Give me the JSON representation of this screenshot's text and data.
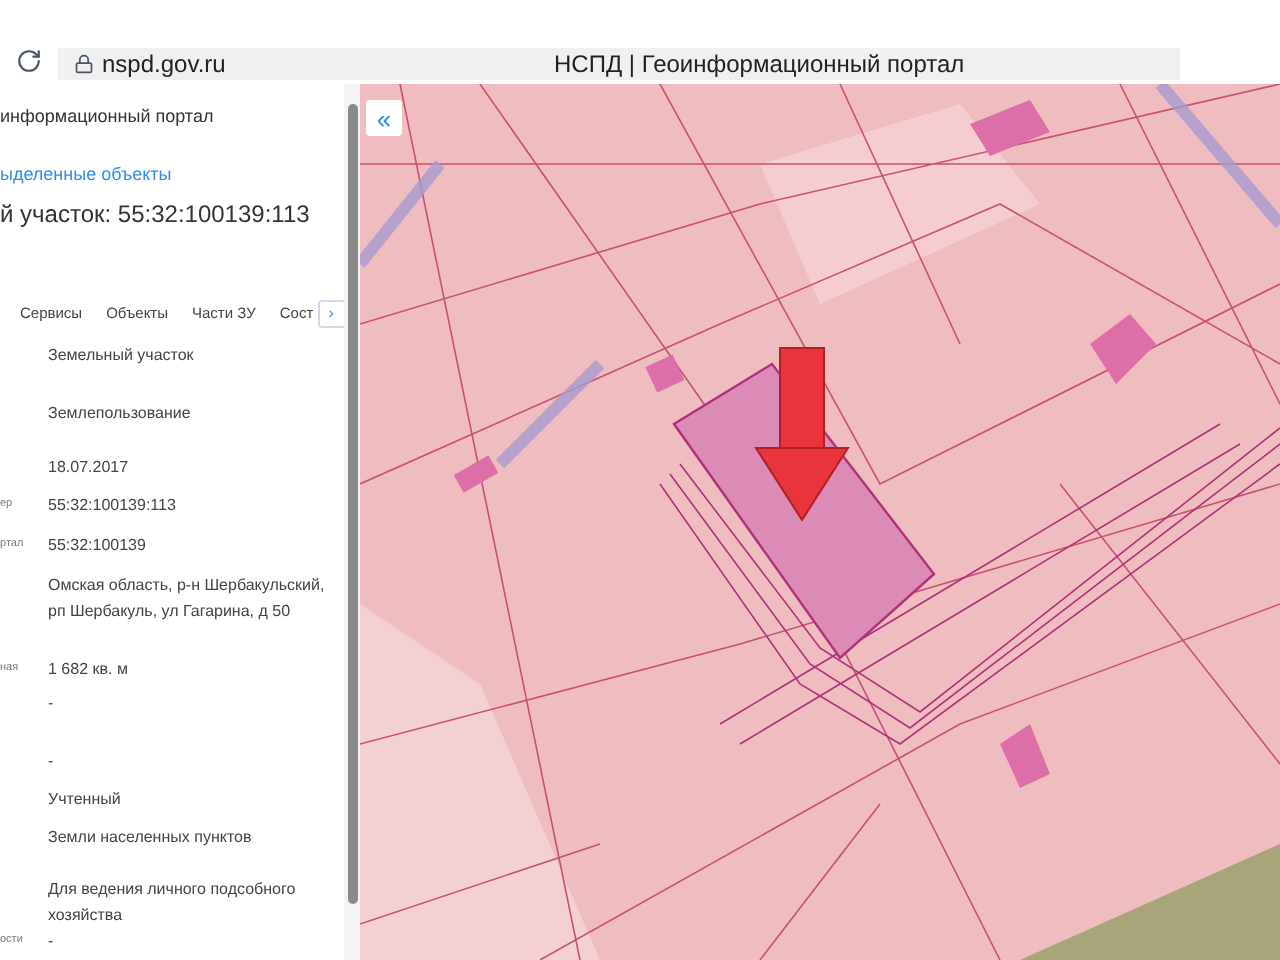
{
  "browser": {
    "url": "nspd.gov.ru",
    "title": "НСПД | Геоинформационный портал"
  },
  "panel": {
    "breadcrumb": "информационный портал",
    "link": "ыделенные объекты",
    "heading": "й участок: 55:32:100139:113",
    "tabs": [
      {
        "label": "Сервисы",
        "selected": false
      },
      {
        "label": "Объекты",
        "selected": false
      },
      {
        "label": "Части ЗУ",
        "selected": false
      },
      {
        "label": "Сост",
        "selected": false
      }
    ],
    "tabs_next": "›",
    "rows": [
      {
        "label": "",
        "value": "Земельный участок"
      },
      {
        "label": "",
        "value": "Землепользование"
      },
      {
        "label": "",
        "value": "18.07.2017"
      },
      {
        "label": "ер",
        "value": "55:32:100139:113"
      },
      {
        "label": "ртал",
        "value": "55:32:100139"
      },
      {
        "label": "",
        "value": "Омская область, р-н Шербакульский, рп Шербакуль, ул Гагарина, д 50"
      },
      {
        "label": "ная",
        "value": "1 682 кв. м"
      },
      {
        "label": "",
        "value": "-"
      },
      {
        "label": "",
        "value": "-"
      },
      {
        "label": "",
        "value": "Учтенный"
      },
      {
        "label": "",
        "value": "Земли населенных пунктов"
      },
      {
        "label": "",
        "value": "Для ведения личного подсобного хозяйства"
      },
      {
        "label": "ости",
        "value": "-"
      }
    ]
  },
  "map": {
    "collapse_button": "«"
  }
}
